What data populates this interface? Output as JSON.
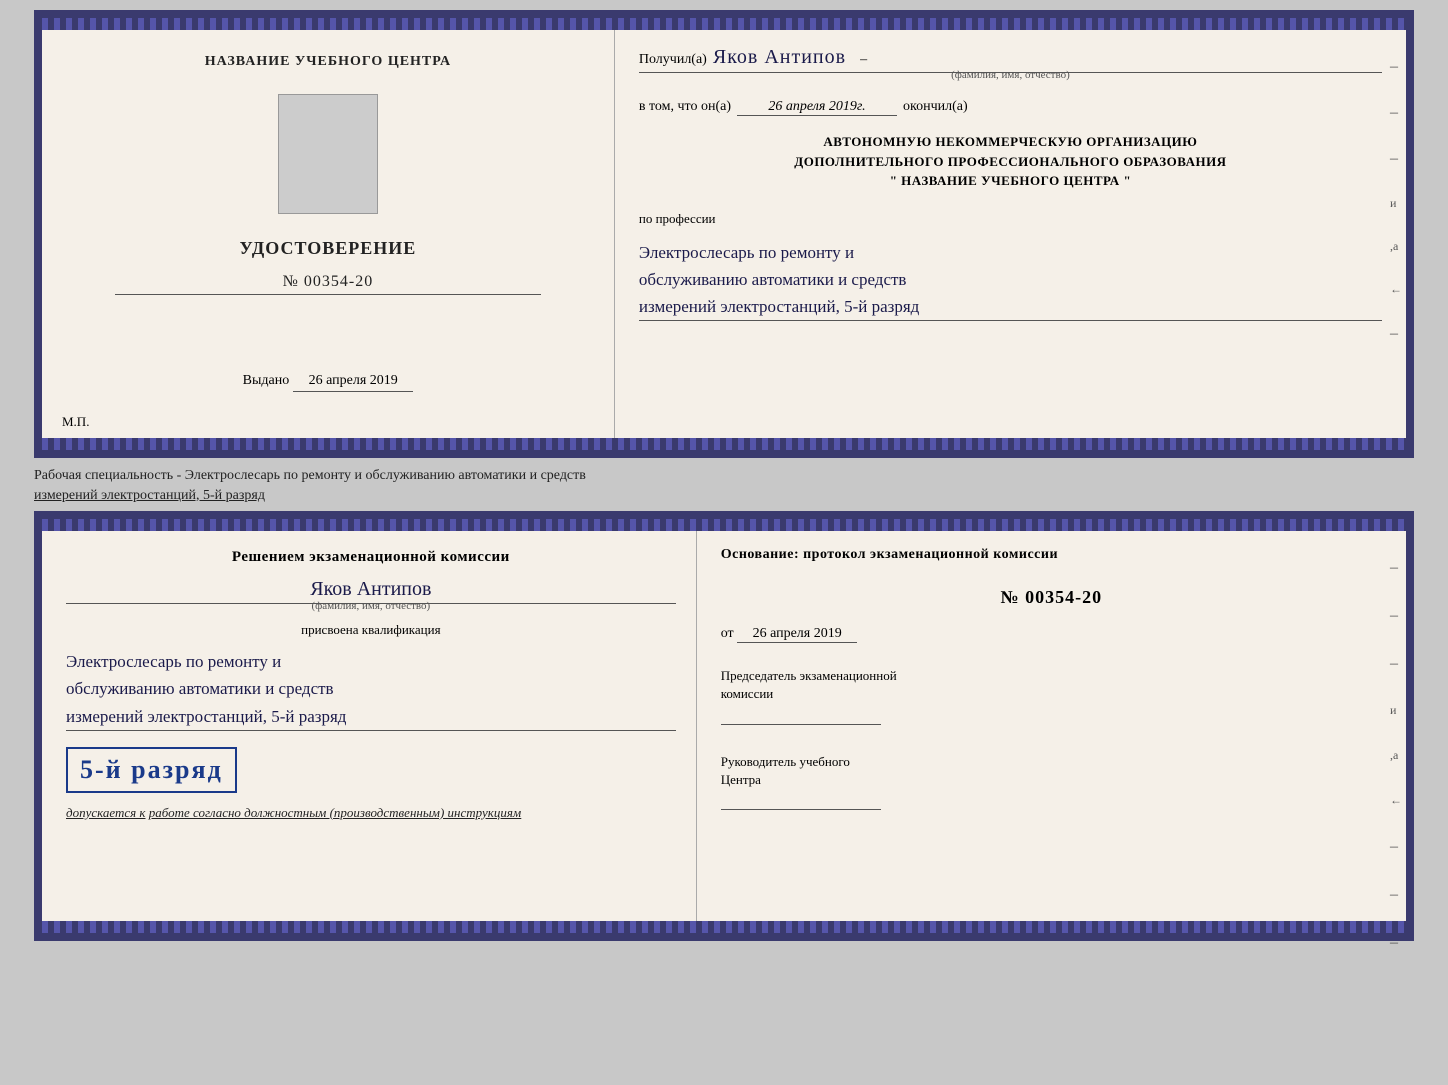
{
  "top_doc": {
    "left": {
      "school_name": "НАЗВАНИЕ УЧЕБНОГО ЦЕНТРА",
      "cert_title": "УДОСТОВЕРЕНИЕ",
      "cert_number": "№ 00354-20",
      "date_label": "Выдано",
      "date_value": "26 апреля 2019",
      "mp_label": "М.П."
    },
    "right": {
      "recipient_label": "Получил(а)",
      "recipient_name": "Яков Антипов",
      "fio_subtitle": "(фамилия, имя, отчество)",
      "date_completed_label": "в том, что он(а)",
      "date_completed_value": "26 апреля 2019г.",
      "completed_label": "окончил(а)",
      "org_line1": "АВТОНОМНУЮ НЕКОММЕРЧЕСКУЮ ОРГАНИЗАЦИЮ",
      "org_line2": "ДОПОЛНИТЕЛЬНОГО ПРОФЕССИОНАЛЬНОГО ОБРАЗОВАНИЯ",
      "org_line3": "\" НАЗВАНИЕ УЧЕБНОГО ЦЕНТРА \"",
      "profession_label": "по профессии",
      "profession_line1": "Электрослесарь по ремонту и",
      "profession_line2": "обслуживанию автоматики и средств",
      "profession_line3": "измерений электростанций, 5-й разряд",
      "side_marks": [
        "-",
        "-",
        "-",
        "и",
        ",а",
        "←",
        "-"
      ]
    }
  },
  "divider_text": "Рабочая специальность - Электрослесарь по ремонту и обслуживанию автоматики и средств\nизмерений электростанций, 5-й разряд",
  "bottom_doc": {
    "left": {
      "commission_heading": "Решением экзаменационной комиссии",
      "name": "Яков Антипов",
      "fio_subtitle": "(фамилия, имя, отчество)",
      "qualification_label": "присвоена квалификация",
      "qualification_line1": "Электрослесарь по ремонту и",
      "qualification_line2": "обслуживанию автоматики и средств",
      "qualification_line3": "измерений электростанций, 5-й разряд",
      "rank_badge": "5-й разряд",
      "allows_label": "допускается к",
      "allows_text": "работе согласно должностным (производственным) инструкциям"
    },
    "right": {
      "foundation_label": "Основание: протокол экзаменационной комиссии",
      "protocol_number": "№ 00354-20",
      "date_prefix": "от",
      "date_value": "26 апреля 2019",
      "chairman_title": "Председатель экзаменационной\nкомиссии",
      "director_title": "Руководитель учебного\nЦентра",
      "side_marks": [
        "-",
        "-",
        "-",
        "и",
        ",а",
        "←",
        "-",
        "-",
        "-"
      ]
    }
  }
}
